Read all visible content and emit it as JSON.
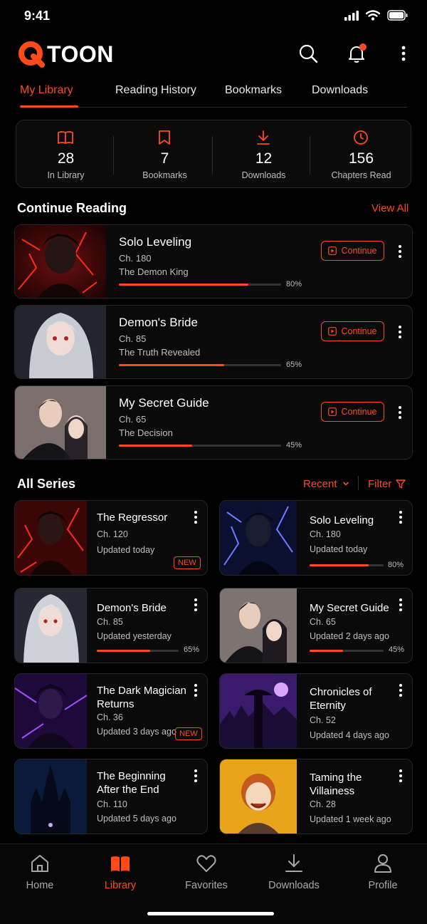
{
  "status": {
    "time": "9:41"
  },
  "app": {
    "logo_text": "TOON",
    "accent": "#ff4a1a"
  },
  "header": {
    "icons": [
      "search-icon",
      "bell-icon",
      "more-vertical-icon"
    ]
  },
  "tabs": [
    "My Library",
    "Reading History",
    "Bookmarks",
    "Downloads"
  ],
  "stats": [
    {
      "icon": "book-icon",
      "value": "28",
      "label": "In Library"
    },
    {
      "icon": "bookmark-icon",
      "value": "7",
      "label": "Bookmarks"
    },
    {
      "icon": "download-icon",
      "value": "12",
      "label": "Downloads"
    },
    {
      "icon": "clock-icon",
      "value": "156",
      "label": "Chapters Read"
    }
  ],
  "continue_reading": {
    "title": "Continue Reading",
    "view_all": "View All",
    "button_label": "Continue",
    "items": [
      {
        "title": "Solo Leveling",
        "chapter": "Ch. 180",
        "subtitle": "The Demon King",
        "progress": 80,
        "progress_label": "80%"
      },
      {
        "title": "Demon's Bride",
        "chapter": "Ch. 85",
        "subtitle": "The Truth Revealed",
        "progress": 65,
        "progress_label": "65%"
      },
      {
        "title": "My Secret Guide",
        "chapter": "Ch. 65",
        "subtitle": "The Decision",
        "progress": 45,
        "progress_label": "45%"
      }
    ]
  },
  "all_series": {
    "title": "All Series",
    "sort_label": "Recent",
    "filter_label": "Filter",
    "new_badge": "NEW",
    "items": [
      {
        "title": "The Regressor",
        "chapter": "Ch. 120",
        "updated": "Updated today",
        "badge": true
      },
      {
        "title": "Solo Leveling",
        "chapter": "Ch. 180",
        "updated": "Updated today",
        "progress": 80,
        "progress_label": "80%"
      },
      {
        "title": "Demon's Bride",
        "chapter": "Ch. 85",
        "updated": "Updated yesterday",
        "progress": 65,
        "progress_label": "65%"
      },
      {
        "title": "My Secret Guide",
        "chapter": "Ch. 65",
        "updated": "Updated 2 days ago",
        "progress": 45,
        "progress_label": "45%"
      },
      {
        "title": "The Dark Magician Returns",
        "chapter": "Ch. 36",
        "updated": "Updated 3 days ago",
        "badge": true
      },
      {
        "title": "Chronicles of Eternity",
        "chapter": "Ch. 52",
        "updated": "Updated 4 days ago"
      },
      {
        "title": "The Beginning After the End",
        "chapter": "Ch. 110",
        "updated": "Updated 5 days ago"
      },
      {
        "title": "Taming the Villainess",
        "chapter": "Ch. 28",
        "updated": "Updated 1 week ago"
      }
    ]
  },
  "bottom_nav": [
    {
      "label": "Home",
      "icon": "home-icon"
    },
    {
      "label": "Library",
      "icon": "library-icon",
      "active": true
    },
    {
      "label": "Favorites",
      "icon": "heart-icon"
    },
    {
      "label": "Downloads",
      "icon": "download-icon"
    },
    {
      "label": "Profile",
      "icon": "profile-icon"
    }
  ]
}
